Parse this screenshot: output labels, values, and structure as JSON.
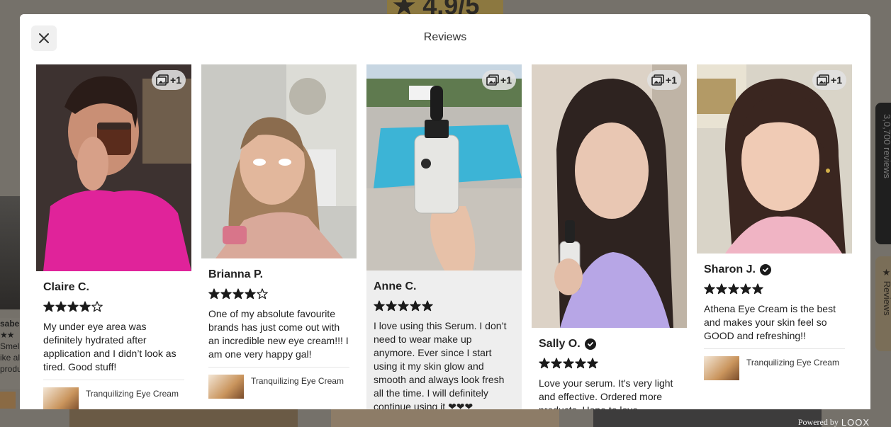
{
  "background": {
    "rating_text": "★ 4.9/5",
    "left_name": "sabe",
    "left_lines": [
      "Smel",
      "ike al",
      "produ"
    ],
    "side_tab_top": "3,0,700 reviews",
    "side_tab_bottom": "★ Reviews",
    "powered_by": "Powered by",
    "powered_brand": "LOOX"
  },
  "modal": {
    "title": "Reviews",
    "close_icon": "close-icon"
  },
  "reviews": [
    {
      "name": "Claire C.",
      "verified": false,
      "rating": 4,
      "has_more_photos": true,
      "more_photos": "+1",
      "text": "My under eye area was definitely hydrated after application and I didn’t look as tired. Good stuff!",
      "product": "Tranquilizing Eye Cream"
    },
    {
      "name": "Brianna P.",
      "verified": false,
      "rating": 4,
      "has_more_photos": false,
      "more_photos": "",
      "text": "One of my absolute favourite brands has just come out with an incredible new eye cream!!! I am one very happy gal!",
      "product": "Tranquilizing Eye Cream"
    },
    {
      "name": "Anne C.",
      "verified": false,
      "rating": 5,
      "has_more_photos": true,
      "more_photos": "+1",
      "text": "I love using this Serum. I don’t need to wear make up anymore. Ever since I start using it my skin glow and smooth and always look fresh all the time. I will definitely continue using it ❤❤❤",
      "product": ""
    },
    {
      "name": "Sally O.",
      "verified": true,
      "rating": 5,
      "has_more_photos": true,
      "more_photos": "+1",
      "text": "Love your serum. It's very light and effective. Ordered more products. Hope to love",
      "product": ""
    },
    {
      "name": "Sharon J.",
      "verified": true,
      "rating": 5,
      "has_more_photos": true,
      "more_photos": "+1",
      "text": "Athena Eye Cream is the best and makes your skin feel so GOOD and refreshing!!",
      "product": "Tranquilizing Eye Cream"
    }
  ],
  "colors": {
    "star": "#1a1a1a",
    "highlight_card": "#eeeeee",
    "magenta_shirt": "#e0239a",
    "pool": "#3cb4d6"
  }
}
